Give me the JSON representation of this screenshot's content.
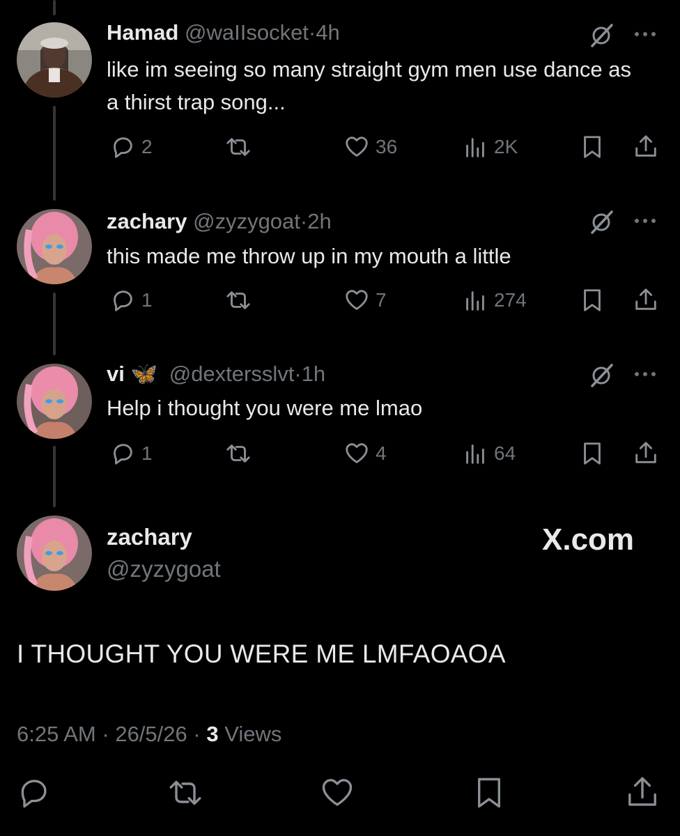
{
  "replies": [
    {
      "name": "Hamad",
      "handle": "@waIIsocket",
      "time": "4h",
      "text": "like im seeing so many straight gym men use dance as a thirst trap song...",
      "replies": "2",
      "likes": "36",
      "views": "2K"
    },
    {
      "name": "zachary",
      "handle": "@zyzygoat",
      "time": "2h",
      "text": "this made me throw up in my mouth a little",
      "replies": "1",
      "likes": "7",
      "views": "274"
    },
    {
      "name": "vi",
      "name_emoji": "🦋",
      "handle": "@dextersslvt",
      "time": "1h",
      "text": "Help i thought you were me lmao",
      "replies": "1",
      "likes": "4",
      "views": "64"
    }
  ],
  "main_post": {
    "name": "zachary",
    "handle": "@zyzygoat",
    "watermark": "X.com",
    "text": "I THOUGHT YOU WERE ME LMFAOAOA",
    "time": "6:25 AM",
    "date": "26/5/26",
    "views_count": "3",
    "views_label": "Views"
  },
  "separator": "·",
  "colors": {
    "background": "#000000",
    "text": "#e7e9ea",
    "muted": "#71767b",
    "thread_line": "#333639",
    "butterfly": "#4aa8ff"
  }
}
